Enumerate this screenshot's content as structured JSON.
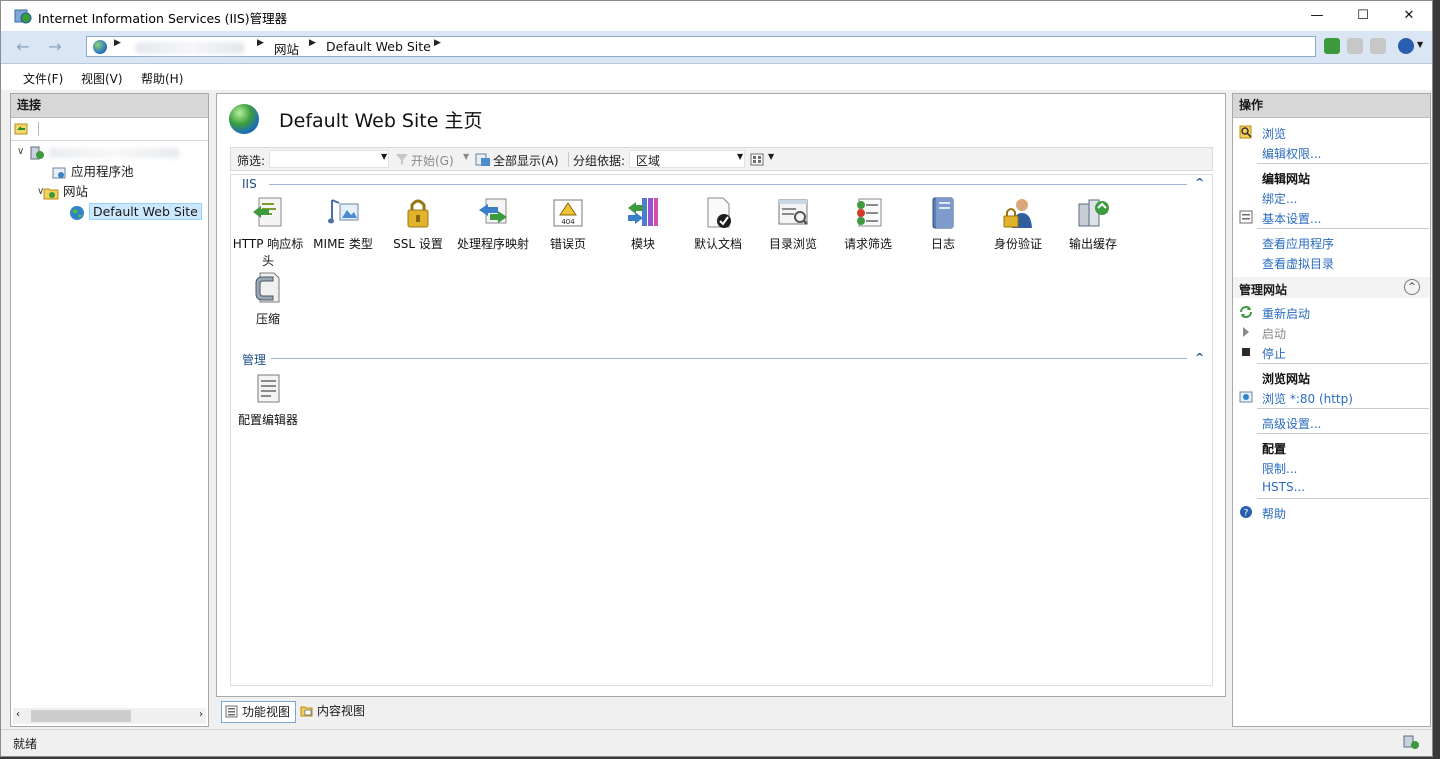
{
  "window": {
    "title": "Internet Information Services (IIS)管理器",
    "min_glyph": "—",
    "max_glyph": "☐",
    "close_glyph": "✕"
  },
  "address": {
    "crumbs": [
      "网站",
      "Default Web Site"
    ],
    "back_glyph": "←",
    "forward_glyph": "→"
  },
  "menu": [
    "文件(F)",
    "视图(V)",
    "帮助(H)"
  ],
  "connections": {
    "header": "连接",
    "tree": {
      "app_pools": "应用程序池",
      "sites": "网站",
      "default_site": "Default Web Site"
    }
  },
  "main": {
    "title": "Default Web Site 主页",
    "filter": {
      "label": "筛选:",
      "start": "开始(G)",
      "show_all": "全部显示(A)",
      "group_label": "分组依据:",
      "group_value": "区域"
    },
    "groups": [
      {
        "title": "IIS",
        "items": [
          "HTTP 响应标头",
          "MIME 类型",
          "SSL 设置",
          "处理程序映射",
          "错误页",
          "模块",
          "默认文档",
          "目录浏览",
          "请求筛选",
          "日志",
          "身份验证",
          "输出缓存",
          "压缩"
        ]
      },
      {
        "title": "管理",
        "items": [
          "配置编辑器"
        ]
      }
    ],
    "icons": [
      "http-response-headers-icon",
      "mime-types-icon",
      "ssl-settings-icon",
      "handler-mappings-icon",
      "error-pages-icon",
      "modules-icon",
      "default-document-icon",
      "directory-browsing-icon",
      "request-filtering-icon",
      "logging-icon",
      "authentication-icon",
      "output-caching-icon",
      "compression-icon"
    ]
  },
  "view_tabs": {
    "features": "功能视图",
    "content": "内容视图"
  },
  "actions": {
    "header": "操作",
    "browse": "浏览",
    "edit_permissions": "编辑权限...",
    "edit_site_header": "编辑网站",
    "bindings": "绑定...",
    "basic_settings": "基本设置...",
    "view_apps": "查看应用程序",
    "view_vdirs": "查看虚拟目录",
    "manage_site_header": "管理网站",
    "restart": "重新启动",
    "start": "启动",
    "stop": "停止",
    "browse_site_header": "浏览网站",
    "browse_80": "浏览 *:80 (http)",
    "advanced": "高级设置...",
    "config_header": "配置",
    "limits": "限制...",
    "hsts": "HSTS...",
    "help": "帮助"
  },
  "status": {
    "text": "就绪"
  },
  "colors": {
    "link": "#2a6cc0",
    "header_bg": "#d7d7d7",
    "address_bg": "#dae6f3",
    "selection": "#cce8ff"
  }
}
